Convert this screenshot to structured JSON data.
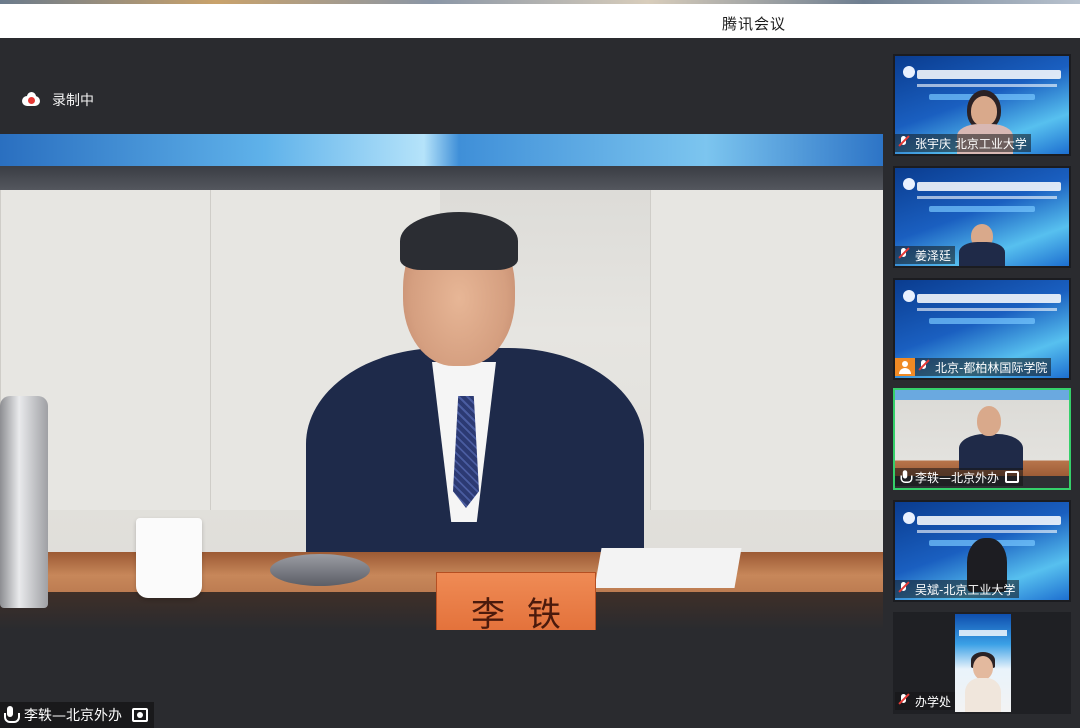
{
  "app": {
    "title": "腾讯会议"
  },
  "recording": {
    "label": "录制中"
  },
  "main_video": {
    "nameplate": "李铁",
    "speaker_label": "李轶—北京外办"
  },
  "participants": [
    {
      "name": "张宇庆 北京工业大学",
      "muted": true,
      "active": false,
      "host": false
    },
    {
      "name": "姜泽廷",
      "muted": true,
      "active": false,
      "host": false
    },
    {
      "name": "北京-都柏林国际学院",
      "muted": true,
      "active": false,
      "host": true
    },
    {
      "name": "李轶—北京外办",
      "muted": false,
      "active": true,
      "host": false,
      "sharing": true
    },
    {
      "name": "吴斌-北京工业大学",
      "muted": true,
      "active": false,
      "host": false
    },
    {
      "name": "办学处",
      "muted": true,
      "active": false,
      "host": false
    }
  ],
  "colors": {
    "active_border": "#35d06a",
    "stage_bg": "#2a2b2f",
    "record_dot": "#e53935",
    "host_badge": "#f08a24"
  },
  "icons": [
    "cloud-record-icon",
    "microphone-icon",
    "microphone-muted-icon",
    "screen-share-icon",
    "host-icon"
  ]
}
